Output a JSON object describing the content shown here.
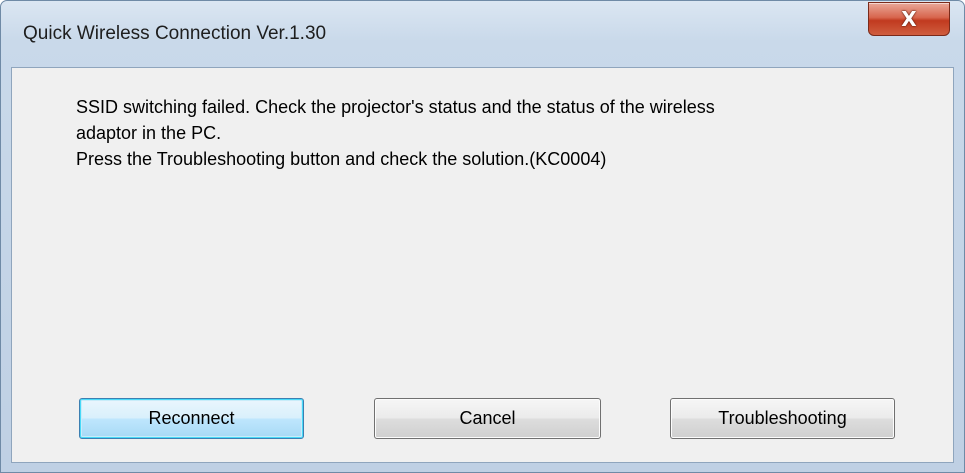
{
  "window": {
    "title": "Quick Wireless Connection Ver.1.30",
    "close_icon": "close-icon",
    "close_glyph": "X"
  },
  "message": {
    "line1": "SSID switching failed. Check the projector's status and the status of the wireless",
    "line2": "adaptor in the PC.",
    "line3": "Press the Troubleshooting button and check the solution.(KC0004)"
  },
  "buttons": {
    "reconnect": "Reconnect",
    "cancel": "Cancel",
    "troubleshooting": "Troubleshooting"
  },
  "colors": {
    "close_button": "#c13a1f",
    "default_button_border": "#3c7fb1",
    "client_background": "#f0f0f0"
  }
}
